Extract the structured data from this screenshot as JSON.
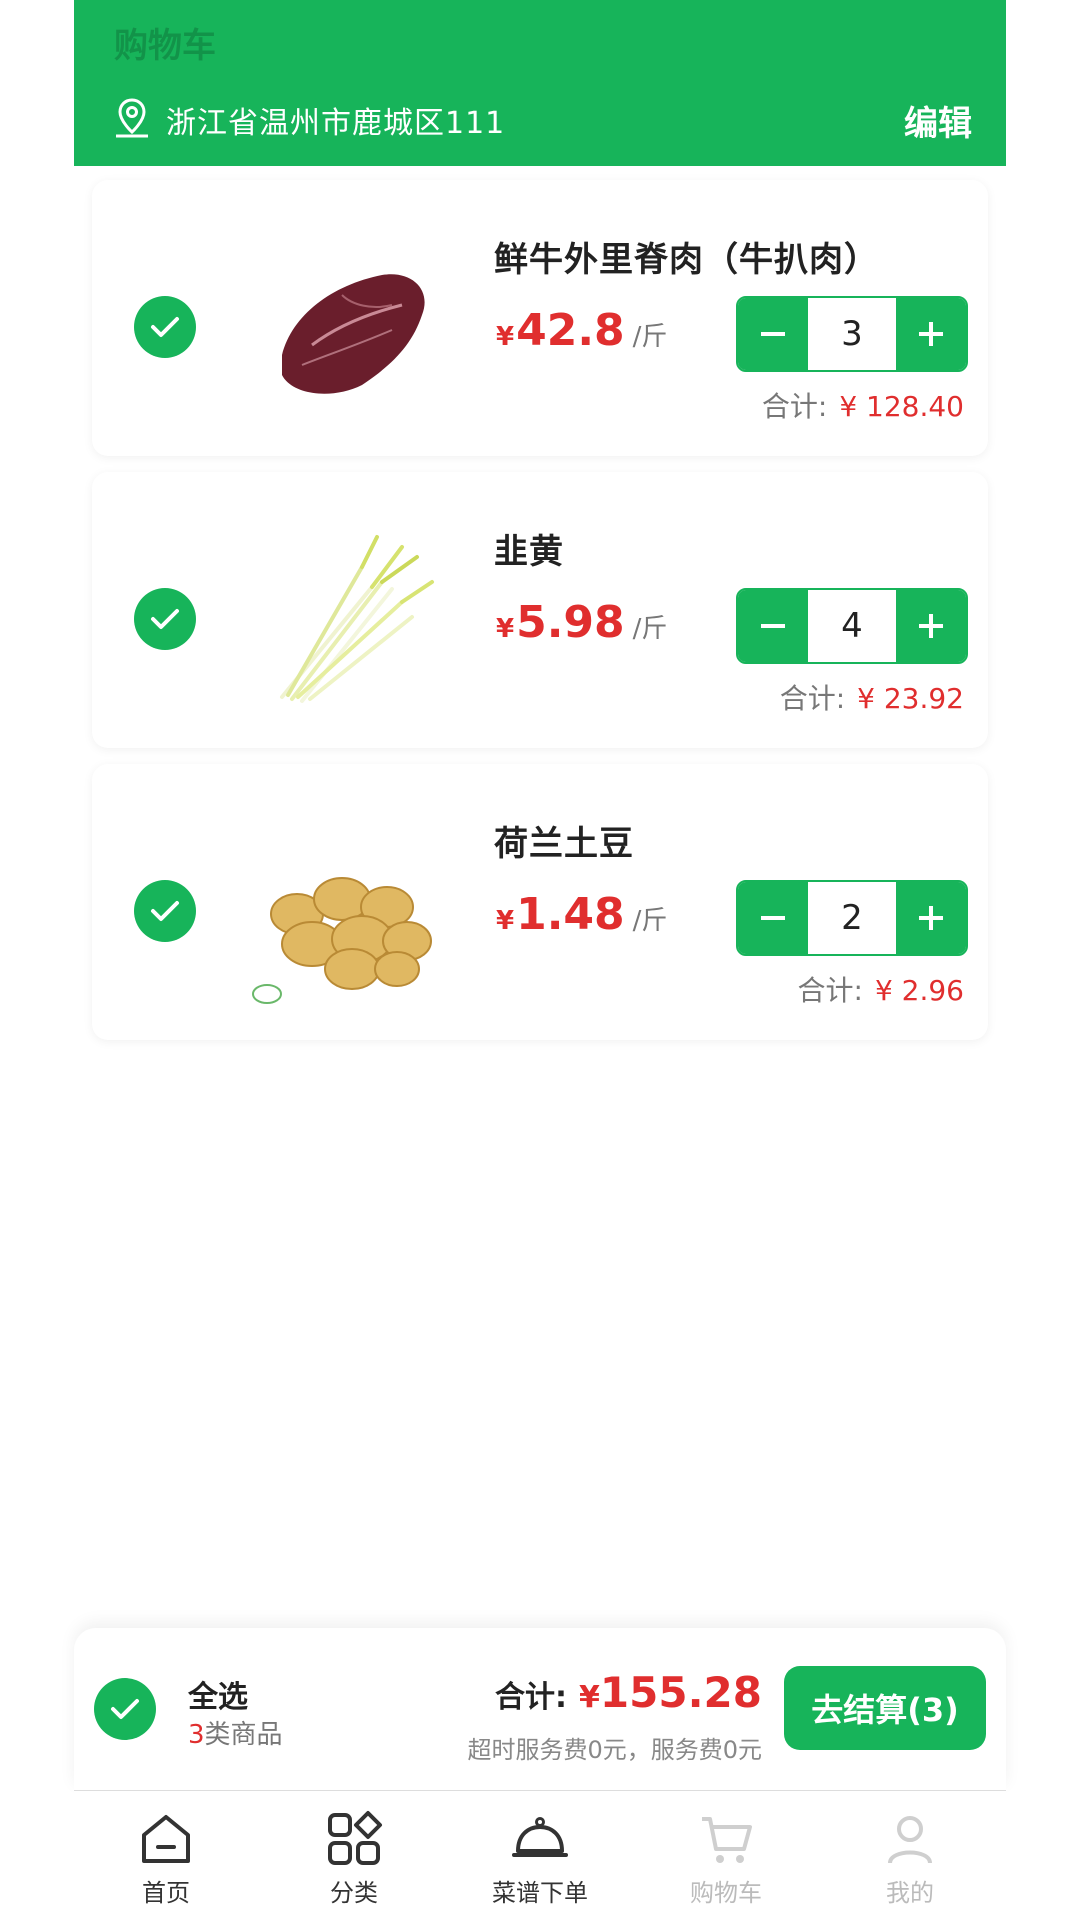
{
  "header": {
    "title": "购物车",
    "address": "浙江省温州市鹿城区111",
    "edit_label": "编辑"
  },
  "items": [
    {
      "name": "鲜牛外里脊肉（牛扒肉）",
      "currency": "¥",
      "price": "42.8",
      "unit": "/斤",
      "quantity": "3",
      "subtotal_label": "合计:",
      "subtotal": "¥ 128.40",
      "image": "beef-image"
    },
    {
      "name": "韭黄",
      "currency": "¥",
      "price": "5.98",
      "unit": "/斤",
      "quantity": "4",
      "subtotal_label": "合计:",
      "subtotal": "¥ 23.92",
      "image": "leek-image"
    },
    {
      "name": "荷兰土豆",
      "currency": "¥",
      "price": "1.48",
      "unit": "/斤",
      "quantity": "2",
      "subtotal_label": "合计:",
      "subtotal": "¥ 2.96",
      "image": "potato-image"
    }
  ],
  "footer": {
    "select_all": "全选",
    "kinds_count": "3",
    "kinds_suffix": "类商品",
    "total_label": "合计:",
    "currency": "¥",
    "total": "155.28",
    "fee_note": "超时服务费0元，服务费0元",
    "checkout_label": "去结算(3)"
  },
  "tabs": [
    {
      "label": "首页",
      "icon": "home-icon"
    },
    {
      "label": "分类",
      "icon": "category-icon"
    },
    {
      "label": "菜谱下单",
      "icon": "cloche-icon"
    },
    {
      "label": "购物车",
      "icon": "cart-icon"
    },
    {
      "label": "我的",
      "icon": "user-icon"
    }
  ],
  "colors": {
    "brand": "#17b45a",
    "price": "#e02e2e"
  }
}
